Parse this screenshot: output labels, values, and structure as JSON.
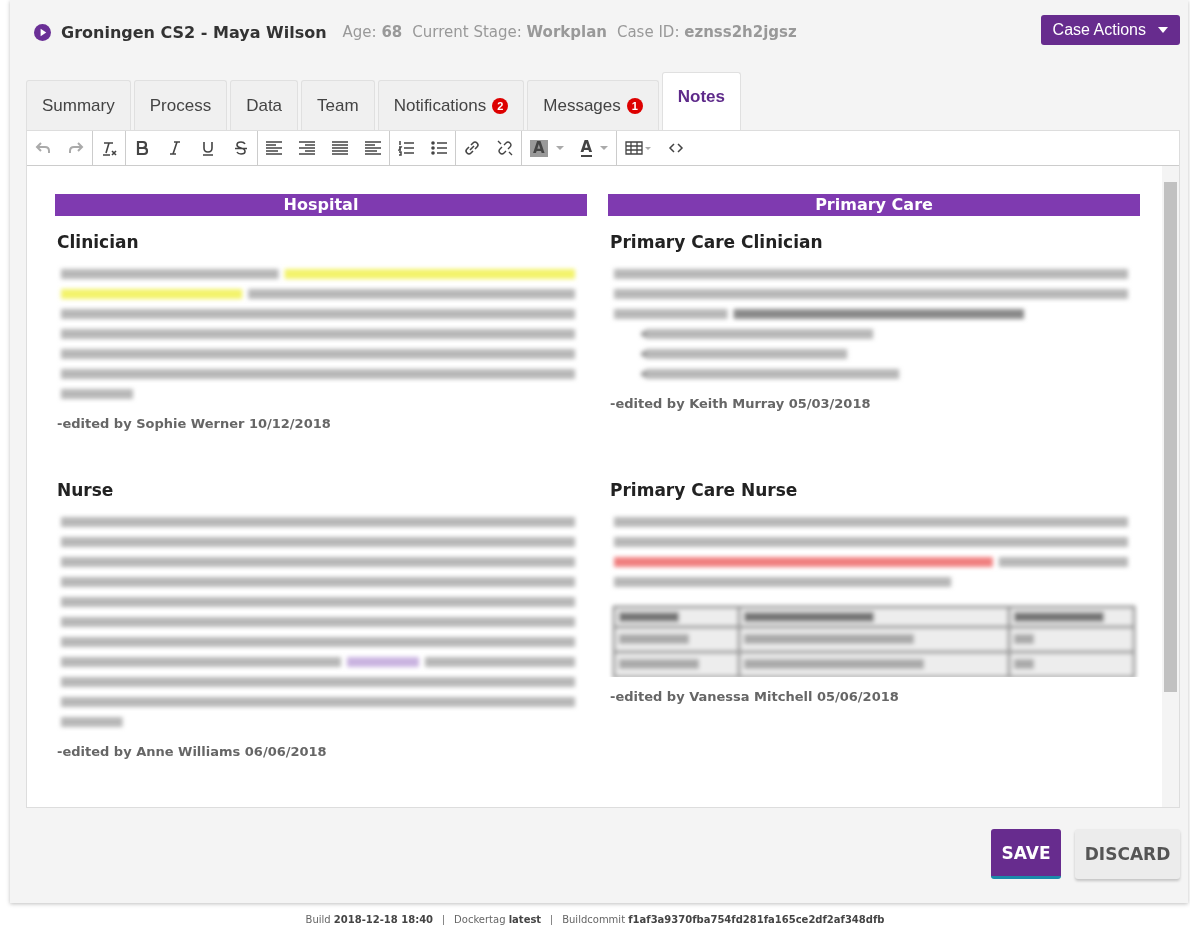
{
  "header": {
    "title": "Groningen CS2 - Maya Wilson",
    "meta": [
      {
        "label": "Age:",
        "value": "68"
      },
      {
        "label": "Current Stage:",
        "value": "Workplan"
      },
      {
        "label": "Case ID:",
        "value": "eznss2h2jgsz"
      }
    ],
    "case_actions": "Case Actions"
  },
  "tabs": [
    {
      "label": "Summary",
      "selected": false
    },
    {
      "label": "Process",
      "selected": false
    },
    {
      "label": "Data",
      "selected": false
    },
    {
      "label": "Team",
      "selected": false
    },
    {
      "label": "Notifications",
      "badge": "2",
      "selected": false
    },
    {
      "label": "Messages",
      "badge": "1",
      "selected": false
    },
    {
      "label": "Notes",
      "selected": true
    }
  ],
  "toolbar": {
    "highlight_glyph": "A",
    "text_color_glyph": "A"
  },
  "columns": [
    {
      "heading": "Hospital",
      "notes": [
        {
          "title": "Clinician",
          "edited": "-edited by Sophie Werner 10/12/2018"
        },
        {
          "title": "Nurse",
          "edited": "-edited by Anne Williams 06/06/2018"
        }
      ]
    },
    {
      "heading": "Primary Care",
      "notes": [
        {
          "title": "Primary Care Clinician",
          "edited": "-edited by Keith Murray 05/03/2018"
        },
        {
          "title": "Primary Care Nurse",
          "edited": "-edited by Vanessa Mitchell 05/06/2018"
        }
      ]
    }
  ],
  "buttons": {
    "save": "SAVE",
    "discard": "DISCARD"
  },
  "footer": [
    {
      "label": "Build",
      "value": "2018-12-18 18:40"
    },
    {
      "label": "Dockertag",
      "value": "latest"
    },
    {
      "label": "Buildcommit",
      "value": "f1af3a9370fba754fd281fa165ce2df2af348dfb"
    }
  ]
}
